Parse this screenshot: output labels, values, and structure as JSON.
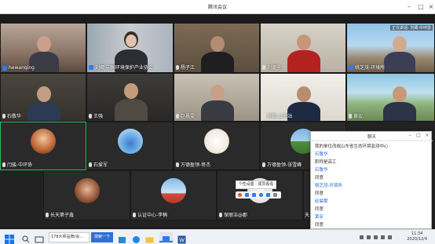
{
  "window": {
    "title": "腾讯会议"
  },
  "participants": [
    {
      "name": "hewanqing",
      "has_user_icon": true
    },
    {
      "name": "刘卿 中国环境保护产业协会",
      "has_user_icon": true
    },
    {
      "name": "杨子江"
    },
    {
      "name": "刘德全"
    },
    {
      "name": "姚芝茂-环境所",
      "speaking_label": "正在讲话: 刘卿·中环协"
    },
    {
      "name": "石敬华"
    },
    {
      "name": "王强"
    },
    {
      "name": "赵晨雯"
    },
    {
      "name": "孙毅-上海站"
    },
    {
      "name": "黄宏"
    },
    {
      "name": "闫骏-中环协",
      "active": true
    },
    {
      "name": "石爱军"
    },
    {
      "name": "万德盈领-佟杰"
    },
    {
      "name": "万德盈领-张雪峰"
    },
    {
      "name": "长天第子鑫"
    },
    {
      "name": "认证中心-李楠"
    },
    {
      "name": "保丽洁@郡"
    },
    {
      "name": "天"
    }
  ],
  "chat": {
    "title": "聊天",
    "messages": [
      {
        "type": "text",
        "text": "我的单位改成山东省生态环境监测中心"
      },
      {
        "type": "sender",
        "text": "石敬华"
      },
      {
        "type": "text",
        "text": "职称是高工"
      },
      {
        "type": "sender",
        "text": "石敬华"
      },
      {
        "type": "text",
        "text": "同意"
      },
      {
        "type": "sender",
        "text": "姚芝茂-环境所"
      },
      {
        "type": "text",
        "text": "同意"
      },
      {
        "type": "sender",
        "text": "赵晨雯"
      },
      {
        "type": "text",
        "text": "同意"
      },
      {
        "type": "sender",
        "text": "黄宏"
      },
      {
        "type": "text",
        "text": "同意"
      }
    ]
  },
  "popup": {
    "text": "个性设置 · 成员看看"
  },
  "taskbar": {
    "app_label": "178大师品牌/会...",
    "search_label": "搜索一下",
    "time": "11:34",
    "date": "2020/12/4"
  },
  "colors": {
    "accent": "#1fc35a",
    "chat_sender": "#2a6ad6"
  }
}
